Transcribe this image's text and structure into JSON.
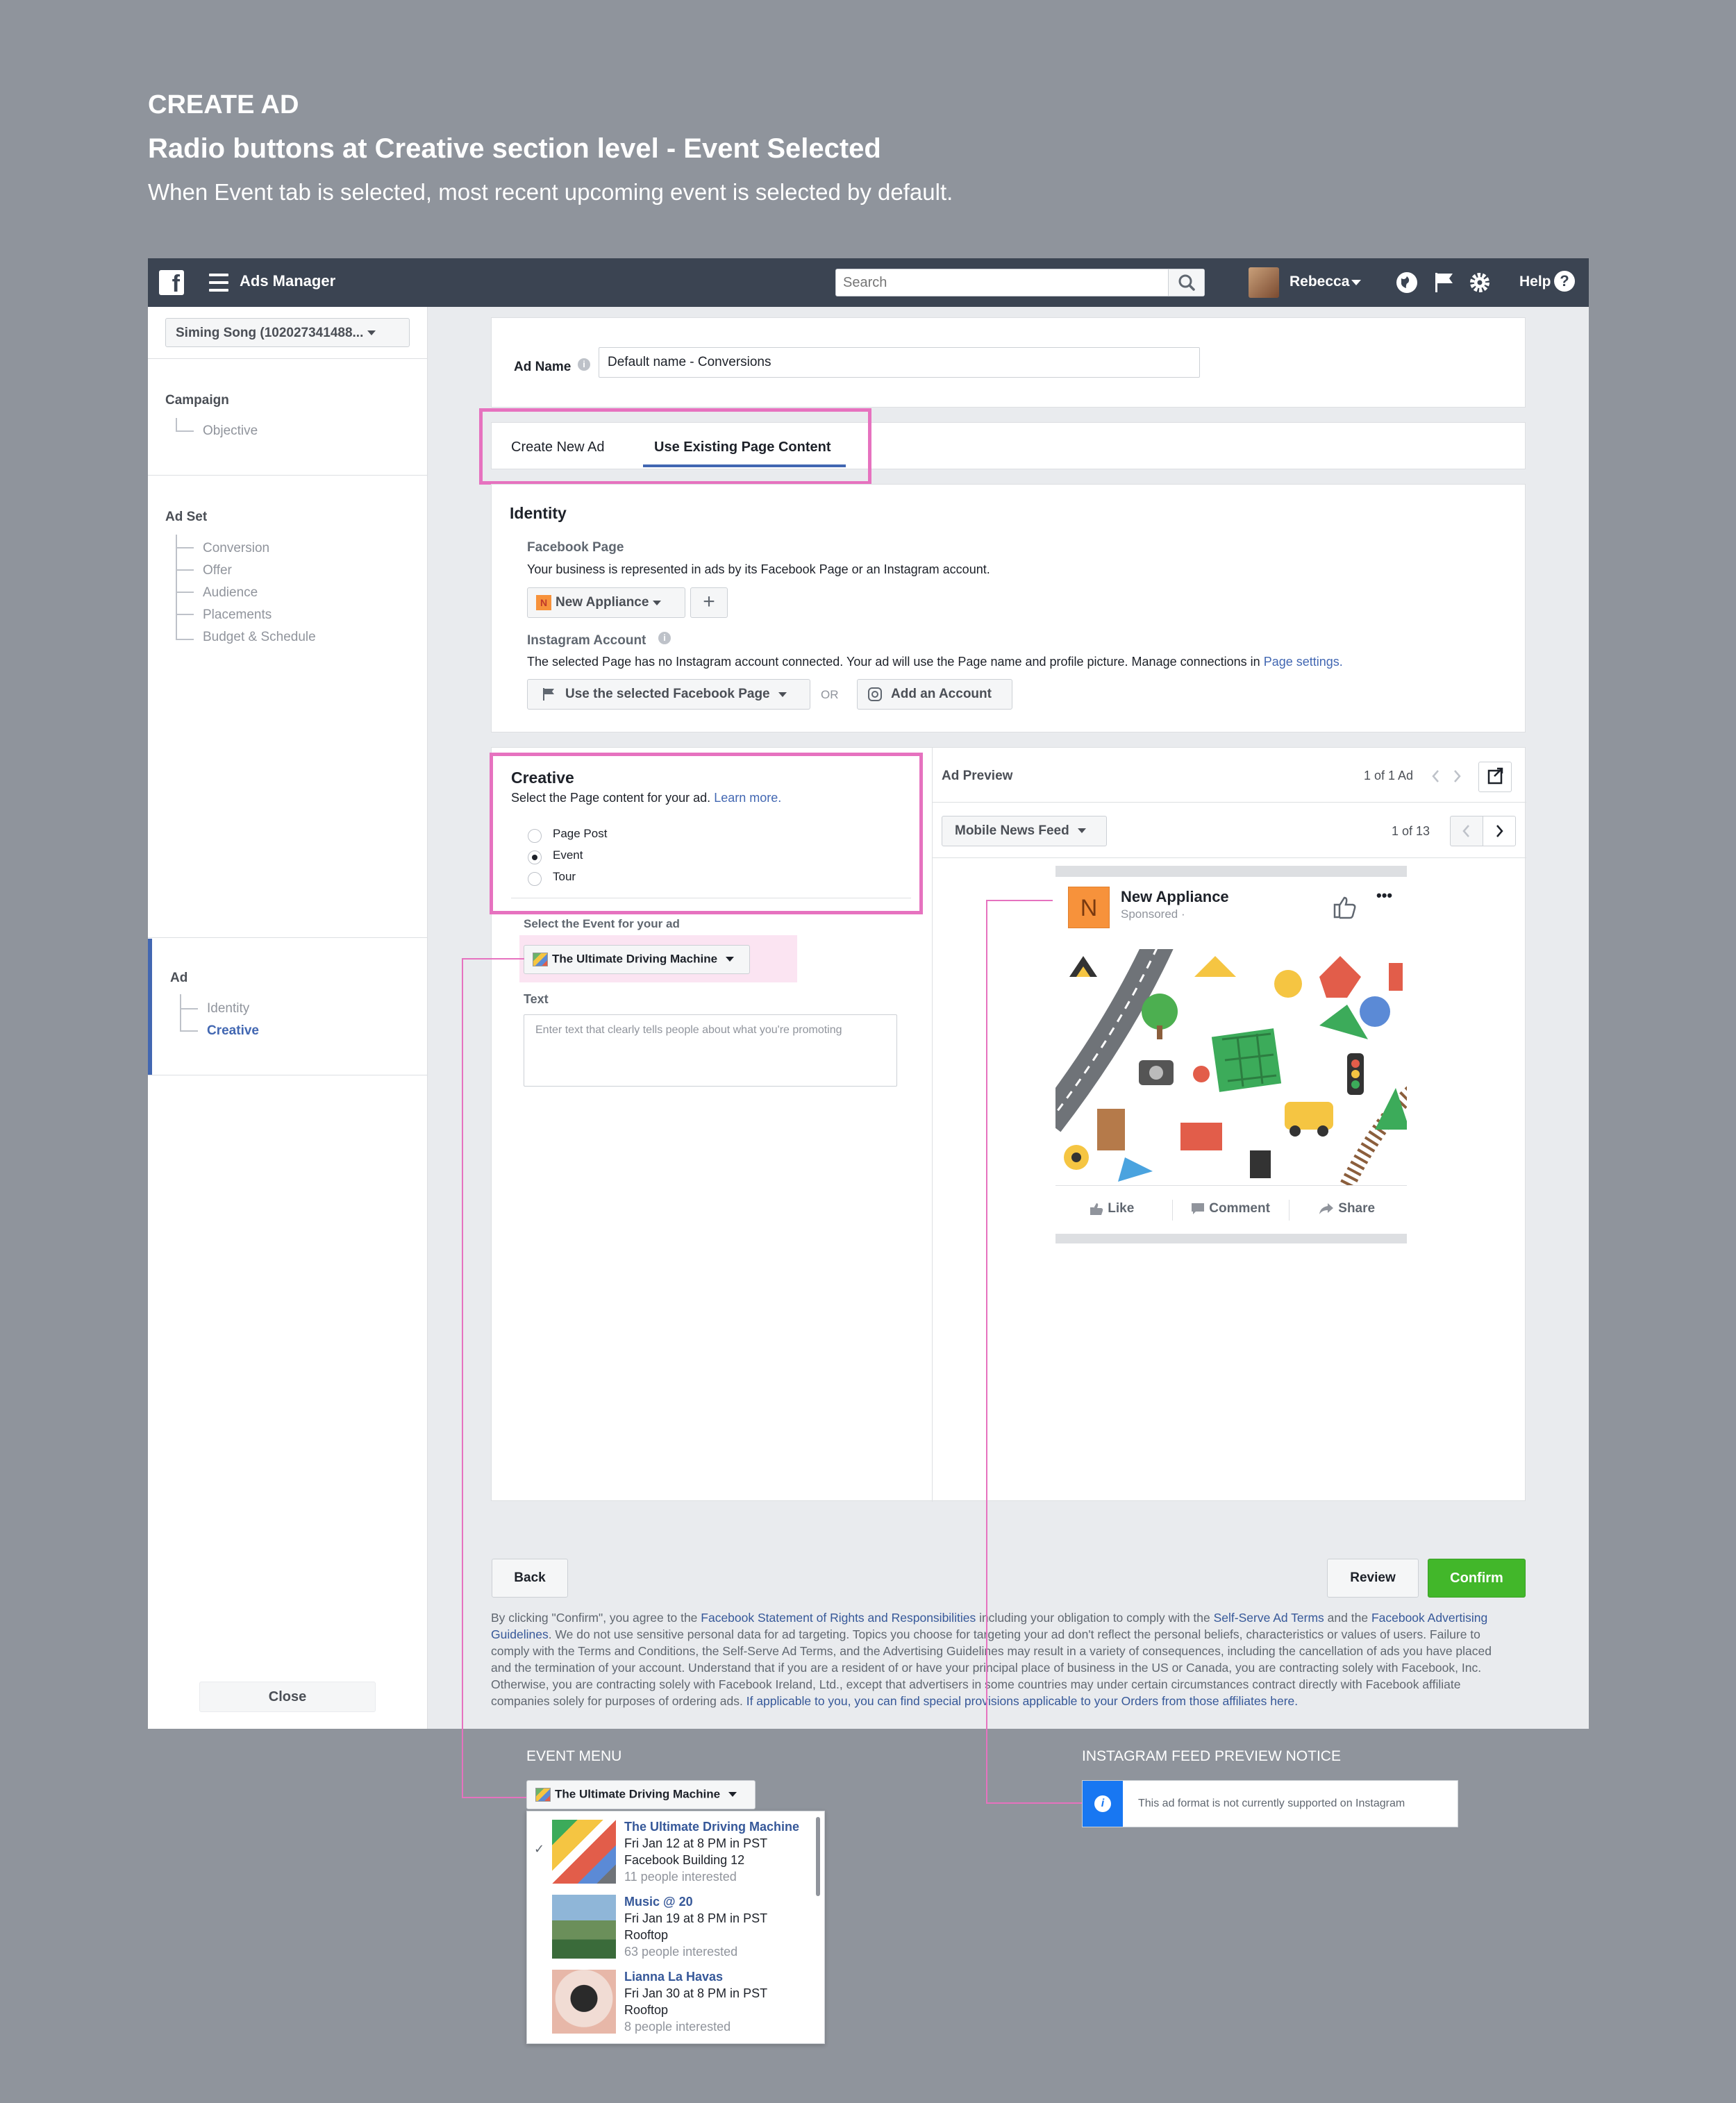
{
  "header": {
    "line1": "CREATE AD",
    "line2": "Radio buttons at Creative section level - Event Selected",
    "line3": "When Event tab is selected, most recent upcoming event is selected by default."
  },
  "topbar": {
    "logo": "f",
    "title": "Ads Manager",
    "search_placeholder": "Search",
    "user": "Rebecca",
    "help": "Help"
  },
  "sidebar": {
    "account": "Siming Song (102027341488...",
    "campaign_heading": "Campaign",
    "campaign_items": [
      "Objective"
    ],
    "adset_heading": "Ad Set",
    "adset_items": [
      "Conversion",
      "Offer",
      "Audience",
      "Placements",
      "Budget & Schedule"
    ],
    "ad_heading": "Ad",
    "ad_items": [
      "Identity",
      "Creative"
    ],
    "close": "Close"
  },
  "ad_name": {
    "label": "Ad Name",
    "value": "Default name - Conversions"
  },
  "tabs": {
    "create_new": "Create New Ad",
    "use_existing": "Use Existing Page Content"
  },
  "identity": {
    "title": "Identity",
    "fb_page_label": "Facebook Page",
    "fb_page_desc": "Your business is represented in ads by its Facebook Page or an Instagram account.",
    "page_badge": "N",
    "page_name": "New Appliance",
    "plus": "+",
    "ig_label": "Instagram Account",
    "ig_desc": "The selected Page has no Instagram account connected. Your ad will use the Page name and profile picture. Manage connections in",
    "ig_link": "Page settings.",
    "use_fb_page": "Use the selected Facebook Page",
    "or": "OR",
    "add_account": "Add an Account"
  },
  "creative": {
    "title": "Creative",
    "desc": "Select the Page content for your ad.",
    "learn_more": "Learn more.",
    "options": [
      "Page Post",
      "Event",
      "Tour"
    ],
    "selected": "Event",
    "select_event_label": "Select the Event for your ad",
    "event_selected": "The Ultimate Driving Machine",
    "text_label": "Text",
    "text_placeholder": "Enter text that clearly tells people about what you're promoting"
  },
  "preview": {
    "title": "Ad Preview",
    "count": "1 of 1 Ad",
    "placement": "Mobile News Feed",
    "placement_count": "1 of 13",
    "page_badge": "N",
    "page_name": "New Appliance",
    "sponsored": "Sponsored ·",
    "more": "•••",
    "like": "Like",
    "comment": "Comment",
    "share": "Share"
  },
  "footer": {
    "back": "Back",
    "review": "Review",
    "confirm": "Confirm"
  },
  "legal": {
    "p1": "By clicking \"Confirm\", you agree to the ",
    "l1": "Facebook Statement of Rights and Responsibilities",
    "p2": " including your obligation to comply with the ",
    "l2": "Self-Serve Ad Terms",
    "p3": " and the ",
    "l3": "Facebook Advertising Guidelines",
    "p4": ". We do not use sensitive personal data for ad targeting. Topics you choose for targeting your ad don't reflect the personal beliefs, characteristics or values of users. Failure to comply with the Terms and Conditions, the Self-Serve Ad Terms, and the Advertising Guidelines may result in a variety of consequences, including the cancellation of ads you have placed and the termination of your account. Understand that if you are a resident of or have your principal place of business in the US or Canada, you are contracting solely with Facebook, Inc. Otherwise, you are contracting solely with Facebook Ireland, Ltd., except that advertisers in some countries may under certain circumstances contract directly with Facebook affiliate companies solely for purposes of ordering ads. ",
    "l4": "If applicable to you, you can find special provisions applicable to your Orders from those affiliates here."
  },
  "event_menu": {
    "caption": "EVENT MENU",
    "selected": "The Ultimate Driving Machine",
    "check": "✓",
    "events": [
      {
        "title": "The Ultimate Driving Machine",
        "date": "Fri Jan 12 at 8 PM in PST",
        "place": "Facebook Building 12",
        "interest": "11 people interested"
      },
      {
        "title": "Music @ 20",
        "date": "Fri Jan 19 at 8 PM in PST",
        "place": "Rooftop",
        "interest": "63 people interested"
      },
      {
        "title": "Lianna La Havas",
        "date": "Fri Jan 30 at 8 PM in PST",
        "place": "Rooftop",
        "interest": "8 people interested"
      }
    ]
  },
  "ig_notice": {
    "caption": "INSTAGRAM FEED PREVIEW NOTICE",
    "icon": "i",
    "text": "This ad format is not currently supported on Instagram"
  },
  "colors": {
    "topbar": "#3b4452",
    "accent_blue": "#4267b2",
    "confirm_green": "#42b72a",
    "highlight_pink": "#e672bf",
    "page_badge_orange": "#f7923b"
  }
}
